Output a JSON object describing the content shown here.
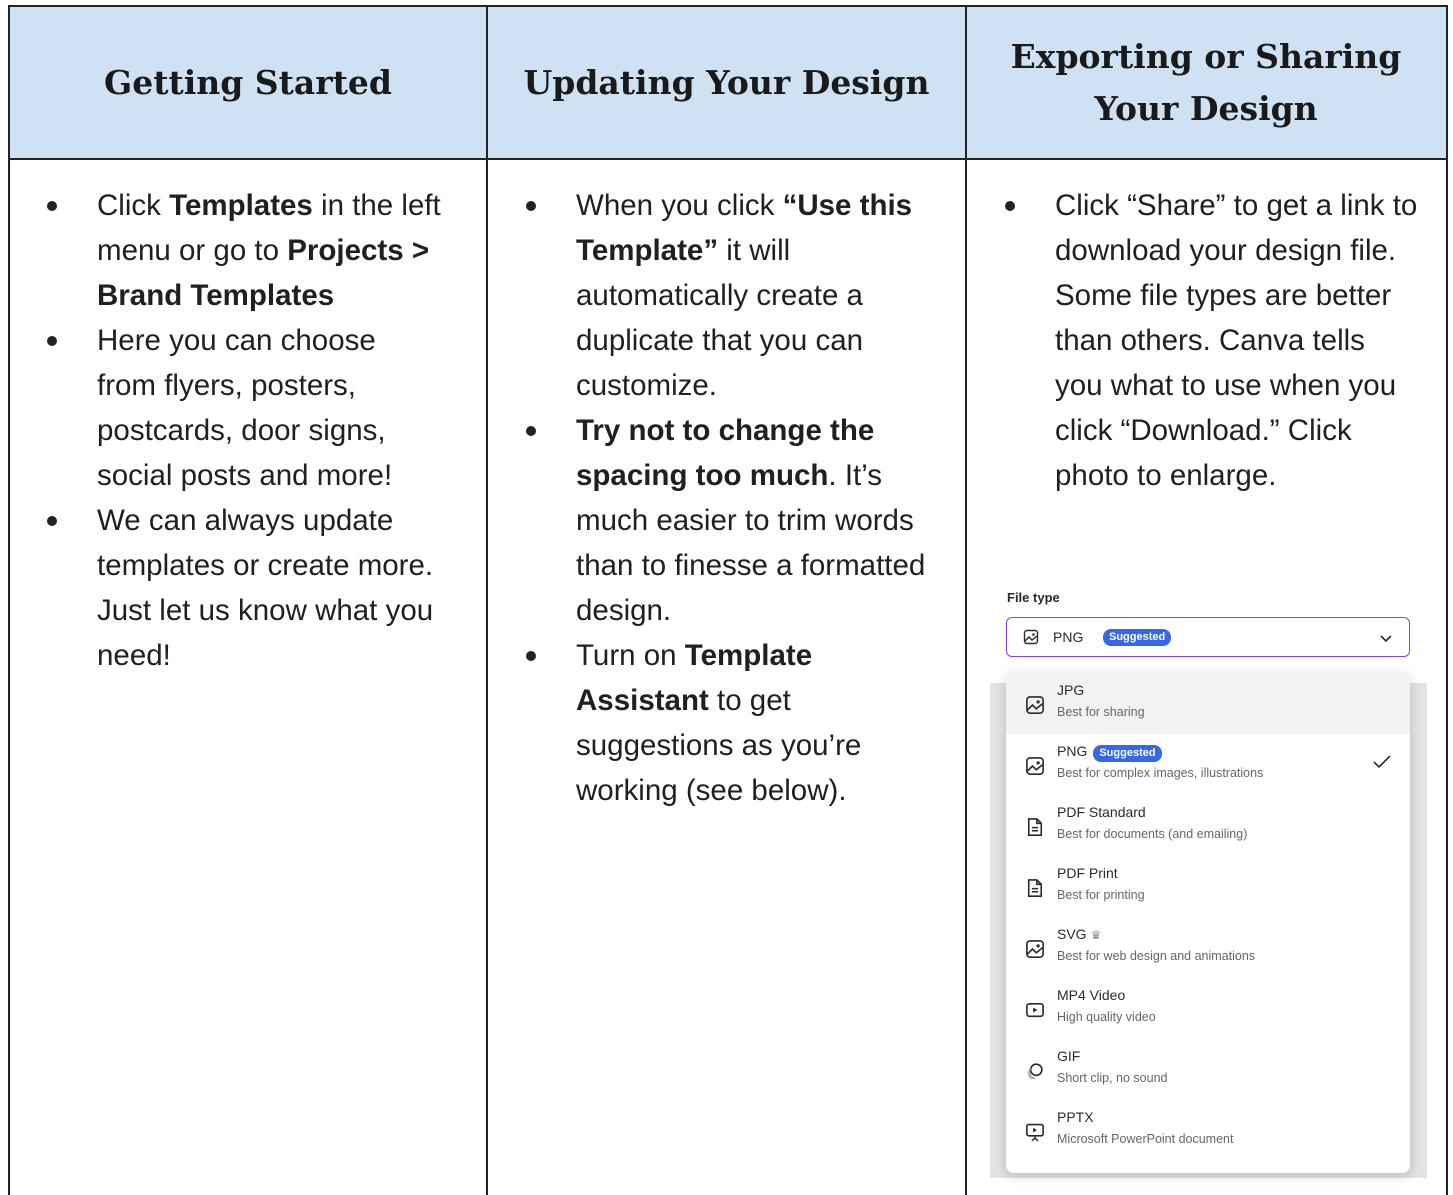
{
  "headers": {
    "col1": "Getting Started",
    "col2": "Updating Your Design",
    "col3": "Exporting or Sharing Your Design"
  },
  "col1": {
    "b1": {
      "t1": "Click ",
      "b2": "Templates",
      "t3": " in the left menu or go to ",
      "b4": "Projects > Brand Templates"
    },
    "b2": {
      "t1": "Here you can choose from flyers, posters, postcards, door signs, social posts and more!"
    },
    "b3": {
      "t1": "We can always update templates or create more. Just let us know what you need!"
    }
  },
  "col2": {
    "b1": {
      "t1": "When you click ",
      "b2": "“Use this Template”",
      "t3": " it will automatically create a duplicate that you can customize."
    },
    "b2": {
      "b1": "Try not to change the spacing too much",
      "t2": ". It’s much easier to trim words than to finesse a formatted design."
    },
    "b3": {
      "t1": "Turn on ",
      "b2": "Template Assistant",
      "t3": " to get suggestions as you’re working (see below)."
    }
  },
  "col3": {
    "b1": {
      "t1": "Click “Share” to get a link to download your design file. Some file types are better than others. Canva tells you what to use when you click “Download.” Click photo to enlarge."
    }
  },
  "file_panel": {
    "label": "File type",
    "selected": {
      "name": "PNG",
      "badge": "Suggested"
    },
    "options": [
      {
        "name": "JPG",
        "desc": "Best for sharing",
        "icon": "image-icon",
        "highlighted": true
      },
      {
        "name": "PNG",
        "badge": "Suggested",
        "desc": "Best for complex images, illustrations",
        "icon": "image-icon",
        "checked": true
      },
      {
        "name": "PDF Standard",
        "desc": "Best for documents (and emailing)",
        "icon": "document-icon"
      },
      {
        "name": "PDF Print",
        "desc": "Best for printing",
        "icon": "document-icon"
      },
      {
        "name": "SVG",
        "desc": "Best for web design and animations",
        "icon": "image-icon",
        "crown": true
      },
      {
        "name": "MP4 Video",
        "desc": "High quality video",
        "icon": "video-icon"
      },
      {
        "name": "GIF",
        "desc": "Short clip, no sound",
        "icon": "gif-icon"
      },
      {
        "name": "PPTX",
        "desc": "Microsoft PowerPoint document",
        "icon": "presentation-icon"
      }
    ]
  },
  "colors": {
    "header_bg": "#cfe2f3",
    "accent_purple": "#8b3dff",
    "badge_blue": "#3567e6"
  }
}
